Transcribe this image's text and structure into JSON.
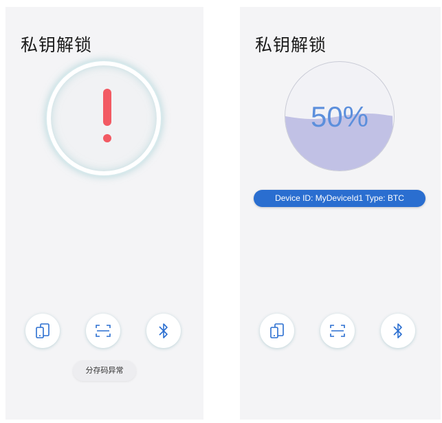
{
  "left": {
    "title": "私钥解锁",
    "toast": "分存码异常",
    "icons": [
      "device-icon",
      "scan-icon",
      "bluetooth-icon"
    ]
  },
  "right": {
    "title": "私钥解锁",
    "progress": {
      "value": 0.5,
      "label": "50%"
    },
    "device_info": "Device ID: MyDeviceId1 Type: BTC",
    "icons": [
      "device-icon",
      "scan-icon",
      "bluetooth-icon"
    ]
  },
  "colors": {
    "warning": "#f25a63",
    "accent_blue": "#2a6ed0",
    "progress_text": "#5c8fdc",
    "wave_fill": "#b9b9e2",
    "background": "#f4f4f6"
  }
}
